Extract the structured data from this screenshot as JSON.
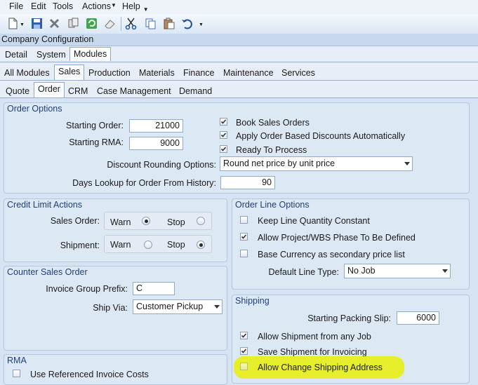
{
  "menu": {
    "file": "File",
    "edit": "Edit",
    "tools": "Tools",
    "actions": "Actions",
    "help": "Help"
  },
  "toolbar": {
    "icons": [
      "new-icon",
      "save-icon",
      "delete-icon",
      "copy-icon",
      "refresh-icon",
      "eraser-icon",
      "cut-icon",
      "copy-doc-icon",
      "paste-icon",
      "undo-icon"
    ]
  },
  "title": "Company Configuration",
  "tabs_main": [
    "Detail",
    "System",
    "Modules"
  ],
  "tabs_modules": [
    "All Modules",
    "Sales",
    "Production",
    "Materials",
    "Finance",
    "Maintenance",
    "Services"
  ],
  "tabs_sales": [
    "Quote",
    "Order",
    "CRM",
    "Case Management",
    "Demand"
  ],
  "order_options": {
    "title": "Order Options",
    "starting_order_label": "Starting Order:",
    "starting_order_value": "21000",
    "starting_rma_label": "Starting RMA:",
    "starting_rma_value": "9000",
    "book_sales_orders": "Book Sales Orders",
    "apply_discounts": "Apply Order Based Discounts Automatically",
    "ready_to_process": "Ready To Process",
    "discount_rounding_label": "Discount Rounding Options:",
    "discount_rounding_value": "Round net price by unit price",
    "days_lookup_label": "Days Lookup for Order From History:",
    "days_lookup_value": "90"
  },
  "credit_limit": {
    "title": "Credit Limit Actions",
    "sales_order_label": "Sales Order:",
    "shipment_label": "Shipment:",
    "warn": "Warn",
    "stop": "Stop"
  },
  "order_line": {
    "title": "Order Line Options",
    "keep_line_qty": "Keep Line Quantity Constant",
    "allow_project": "Allow Project/WBS Phase To Be Defined",
    "base_currency": "Base Currency as secondary price list",
    "default_line_type_label": "Default Line Type:",
    "default_line_type_value": "No Job"
  },
  "counter_sales": {
    "title": "Counter Sales Order",
    "invoice_prefix_label": "Invoice Group Prefix:",
    "invoice_prefix_value": "C",
    "ship_via_label": "Ship Via:",
    "ship_via_value": "Customer Pickup"
  },
  "shipping": {
    "title": "Shipping",
    "starting_packing_label": "Starting Packing Slip:",
    "starting_packing_value": "6000",
    "allow_shipment_any_job": "Allow Shipment from any Job",
    "save_shipment_invoicing": "Save Shipment for Invoicing",
    "allow_change_address": "Allow Change Shipping Address"
  },
  "rma": {
    "title": "RMA",
    "use_referenced_invoice": "Use Referenced Invoice Costs"
  },
  "colors": {
    "highlight": "#e8f017",
    "group_title": "#1f3f7a"
  }
}
